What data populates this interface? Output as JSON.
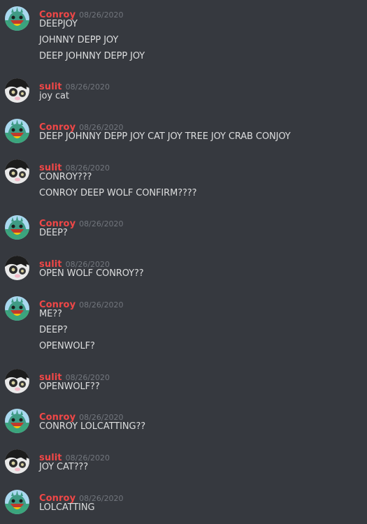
{
  "colors": {
    "background": "#36393f",
    "username": "#f04747",
    "timestamp": "#72767d",
    "message_text": "#dcddde"
  },
  "users": {
    "conroy": {
      "name": "Conroy",
      "avatar_icon": "conroy-avatar-icon"
    },
    "sulit": {
      "name": "sulit",
      "avatar_icon": "sulit-cat-avatar-icon"
    }
  },
  "messages": [
    {
      "author": "Conroy",
      "avatar": "conroy",
      "timestamp": "08/26/2020",
      "lines": [
        "DEEPJOY",
        "JOHNNY DEPP JOY",
        "DEEP JOHNNY DEPP JOY"
      ]
    },
    {
      "author": "sulit",
      "avatar": "sulit",
      "timestamp": "08/26/2020",
      "lines": [
        "joy cat"
      ]
    },
    {
      "author": "Conroy",
      "avatar": "conroy",
      "timestamp": "08/26/2020",
      "lines": [
        "DEEP JOHNNY DEPP JOY CAT JOY TREE JOY CRAB CONJOY"
      ]
    },
    {
      "author": "sulit",
      "avatar": "sulit",
      "timestamp": "08/26/2020",
      "lines": [
        "CONROY???",
        "CONROY DEEP WOLF CONFIRM????"
      ]
    },
    {
      "author": "Conroy",
      "avatar": "conroy",
      "timestamp": "08/26/2020",
      "lines": [
        "DEEP?"
      ]
    },
    {
      "author": "sulit",
      "avatar": "sulit",
      "timestamp": "08/26/2020",
      "lines": [
        "OPEN WOLF CONROY??"
      ]
    },
    {
      "author": "Conroy",
      "avatar": "conroy",
      "timestamp": "08/26/2020",
      "lines": [
        "ME??",
        "DEEP?",
        "OPENWOLF?"
      ]
    },
    {
      "author": "sulit",
      "avatar": "sulit",
      "timestamp": "08/26/2020",
      "lines": [
        "OPENWOLF??"
      ]
    },
    {
      "author": "Conroy",
      "avatar": "conroy",
      "timestamp": "08/26/2020",
      "lines": [
        "CONROY LOLCATTING??"
      ]
    },
    {
      "author": "sulit",
      "avatar": "sulit",
      "timestamp": "08/26/2020",
      "lines": [
        "JOY CAT???"
      ]
    },
    {
      "author": "Conroy",
      "avatar": "conroy",
      "timestamp": "08/26/2020",
      "lines": [
        "LOLCATTING"
      ]
    }
  ]
}
